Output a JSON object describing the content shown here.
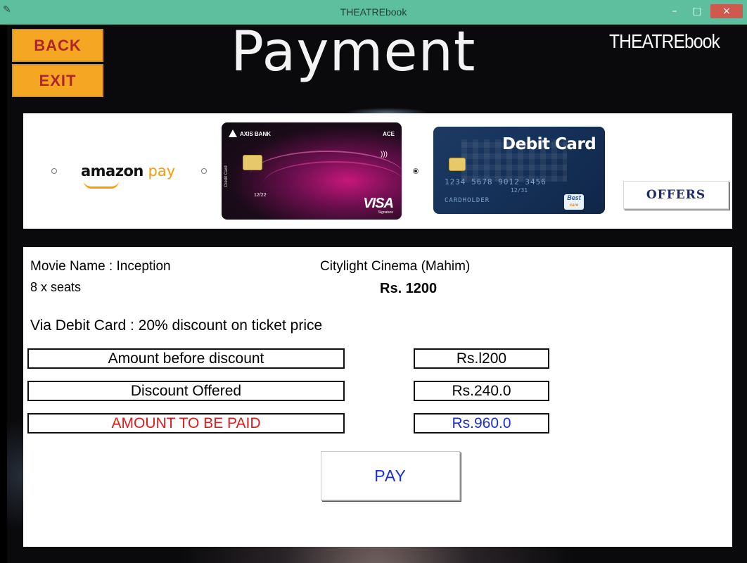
{
  "window": {
    "title": "THEATREbook",
    "minimize_glyph": "–",
    "maximize_glyph": "□",
    "close_glyph": "×"
  },
  "header": {
    "back_label": "BACK",
    "exit_label": "EXIT",
    "page_title": "Payment",
    "brand": "THEATREbook"
  },
  "payment_options": {
    "selected": "debit-card",
    "amazon": {
      "word": "amazon",
      "pay": "pay"
    },
    "credit_card": {
      "bank": "AXIS BANK",
      "tier": "ACE",
      "expiry": "12/22",
      "vertical_text": "Credit Card",
      "network": "VISA",
      "network_sub": "Signature"
    },
    "debit_card": {
      "label": "Debit Card",
      "number": "1234 5678 9012 3456",
      "valid": "12/31",
      "holder": "CARDHOLDER",
      "badge": "Best",
      "badge_sub": "care"
    },
    "offers_label": "OFFERS"
  },
  "details": {
    "movie_name": "Movie Name : Inception",
    "cinema": "Citylight Cinema (Mahim)",
    "seats": "8 x seats",
    "price": "Rs. 1200",
    "discount_note": "Via Debit Card :  20% discount on ticket price",
    "rows": [
      {
        "label": "Amount before discount",
        "value": "Rs.l200"
      },
      {
        "label": "Discount Offered",
        "value": "Rs.240.0"
      },
      {
        "label": "AMOUNT TO BE PAID",
        "value": "Rs.960.0"
      }
    ],
    "pay_label": "PAY"
  },
  "colors": {
    "titlebar": "#5ebf9f",
    "nav_button": "#f5a623",
    "nav_text": "#b1252a",
    "amount_due_label": "#e01b1b",
    "amount_due_value": "#1a2fd6",
    "pay_text": "#1a2fd6"
  }
}
